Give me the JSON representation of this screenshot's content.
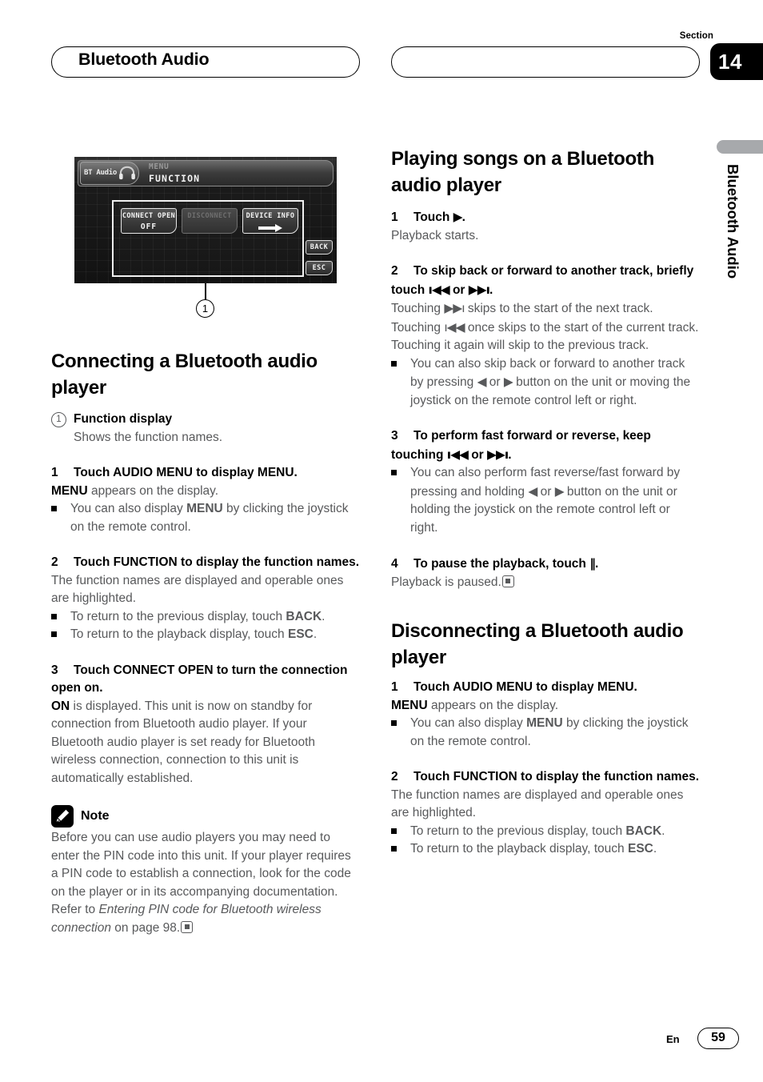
{
  "header": {
    "title": "Bluetooth Audio",
    "section_label": "Section",
    "section_number": "14",
    "right_pill_text": ""
  },
  "side_tab": {
    "label": "Bluetooth Audio"
  },
  "figure": {
    "callout_number": "1",
    "device_screen": {
      "source_label": "BT Audio",
      "menu_label": "MENU",
      "function_label": "FUNCTION",
      "buttons": [
        {
          "label": "CONNECT OPEN",
          "value": "OFF",
          "state": "active"
        },
        {
          "label": "DISCONNECT",
          "value": "",
          "state": "dimmed"
        },
        {
          "label": "DEVICE INFO",
          "value": "arrow",
          "state": "active"
        }
      ],
      "side_buttons": [
        {
          "label": "BACK"
        },
        {
          "label": "ESC"
        }
      ]
    }
  },
  "left_column": {
    "heading": "Connecting a Bluetooth audio player",
    "callout_item": {
      "number": "1",
      "title": "Function display",
      "desc": "Shows the function names."
    },
    "step1": {
      "num": "1",
      "head": "Touch AUDIO MENU to display MENU.",
      "body_bold": "MENU",
      "body_rest": " appears on the display.",
      "bullet_a": "You can also display ",
      "bullet_a_bold": "MENU",
      "bullet_a_rest": " by clicking the joystick on the remote control."
    },
    "step2": {
      "num": "2",
      "head": "Touch FUNCTION to display the function names.",
      "body": "The function names are displayed and operable ones are highlighted.",
      "bullet_a": "To return to the previous display, touch ",
      "bullet_a_bold": "BACK",
      "bullet_a_rest": ".",
      "bullet_b": "To return to the playback display, touch ",
      "bullet_b_bold": "ESC",
      "bullet_b_rest": "."
    },
    "step3": {
      "num": "3",
      "head": "Touch CONNECT OPEN to turn the connection open on.",
      "body_bold": "ON",
      "body_rest": " is displayed. This unit is now on standby for connection from Bluetooth audio player. If your Bluetooth audio player is set ready for Bluetooth wireless connection, connection to this unit is automatically established."
    },
    "note": {
      "icon": "pencil-icon",
      "label": "Note",
      "text_a": "Before you can use audio players you may need to enter the PIN code into this unit. If your player requires a PIN code to establish a connection, look for the code on the player or in its accompanying documentation. Refer to ",
      "text_italic": "Entering PIN code for Bluetooth wireless connection",
      "text_b": " on page 98."
    }
  },
  "right_column": {
    "heading1": "Playing songs on a Bluetooth audio player",
    "step1": {
      "num": "1",
      "head_a": "Touch ",
      "head_glyph": "▶",
      "head_b": ".",
      "body": "Playback starts."
    },
    "step2": {
      "num": "2",
      "head_a": "To skip back or forward to another track, briefly touch ",
      "head_glyph_prev": "ı◀◀",
      "head_or": " or ",
      "head_glyph_next": "▶▶ı",
      "head_b": ".",
      "body_a": "Touching ",
      "body_glyph_next": "▶▶ı",
      "body_b": " skips to the start of the next track. Touching ",
      "body_glyph_prev": "ı◀◀",
      "body_c": " once skips to the start of the current track. Touching it again will skip to the previous track.",
      "bullet_a": "You can also skip back or forward to another track by pressing ",
      "bullet_glyph_l": "◀",
      "bullet_or": " or ",
      "bullet_glyph_r": "▶",
      "bullet_b": " button on the unit or moving the joystick on the remote control left or right."
    },
    "step3": {
      "num": "3",
      "head_a": "To perform fast forward or reverse, keep touching ",
      "head_glyph_prev": "ı◀◀",
      "head_or": " or ",
      "head_glyph_next": "▶▶ı",
      "head_b": ".",
      "bullet_a": "You can also perform fast reverse/fast forward by pressing and holding ",
      "bullet_glyph_l": "◀",
      "bullet_or": " or ",
      "bullet_glyph_r": "▶",
      "bullet_b": " button on the unit or holding the joystick on the remote control left or right."
    },
    "step4": {
      "num": "4",
      "head_a": "To pause the playback, touch ",
      "head_glyph": "‖",
      "head_b": ".",
      "body": "Playback is paused."
    },
    "heading2": "Disconnecting a Bluetooth audio player",
    "d_step1": {
      "num": "1",
      "head": "Touch AUDIO MENU to display MENU.",
      "body_bold": "MENU",
      "body_rest": " appears on the display.",
      "bullet_a": "You can also display ",
      "bullet_a_bold": "MENU",
      "bullet_a_rest": " by clicking the joystick on the remote control."
    },
    "d_step2": {
      "num": "2",
      "head": "Touch FUNCTION to display the function names.",
      "body": "The function names are displayed and operable ones are highlighted.",
      "bullet_a": "To return to the previous display, touch ",
      "bullet_a_bold": "BACK",
      "bullet_a_rest": ".",
      "bullet_b": "To return to the playback display, touch ",
      "bullet_b_bold": "ESC",
      "bullet_b_rest": "."
    }
  },
  "footer": {
    "language": "En",
    "page_number": "59"
  }
}
